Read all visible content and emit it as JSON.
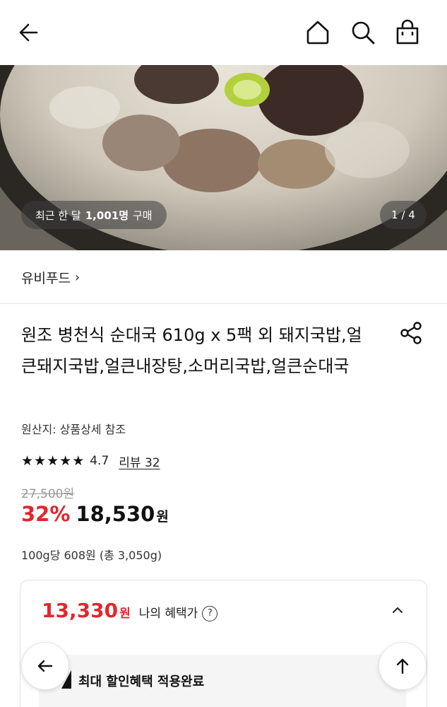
{
  "header": {
    "back_icon": "arrow-left-icon",
    "home_icon": "home-icon",
    "search_icon": "search-icon",
    "cart_icon": "shopping-bag-icon"
  },
  "hero": {
    "purchase_prefix": "최근 한 달",
    "purchase_count": "1,001명",
    "purchase_suffix": "구매",
    "page_indicator": "1 / 4"
  },
  "brand": {
    "name": "유비푸드",
    "chevron": "›"
  },
  "product": {
    "title": "원조 병천식 순대국 610g x 5팩 외 돼지국밥,얼큰돼지국밥,얼큰내장탕,소머리국밥,얼큰순대국",
    "origin": "원산지: 상품상세 참조",
    "rating": "4.7",
    "rating_stars": 4.7,
    "review_label": "리뷰 32",
    "original_price": "27,500원",
    "discount": "32%",
    "price": "18,530",
    "currency": "원",
    "unit_price": "100g당 608원 (총 3,050g)"
  },
  "benefit": {
    "price": "13,330",
    "currency": "원",
    "label": "나의 혜택가",
    "help": "?",
    "applied_label": "최대 할인혜택 적용완료"
  },
  "colors": {
    "accent_red": "#e3262c",
    "text": "#111111",
    "muted": "#999999"
  }
}
